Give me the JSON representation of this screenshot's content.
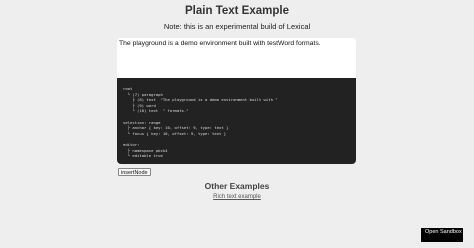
{
  "header": {
    "title": "Plain Text Example",
    "note": "Note: this is an experimental build of Lexical"
  },
  "editor": {
    "text": "The playground is a demo environment built with testWord formats."
  },
  "tree_view": {
    "lines": [
      "root",
      "  └ (7) paragraph",
      "    ├ (8) text  \"The playground is a demo environment built with \"",
      "    ├ (9) word",
      "    └ (10) text  \" formats.\"",
      "",
      "selection: range",
      "  ├ anchor { key: 10, offset: 9, type: text }",
      "  └ focus { key: 10, offset: 9, type: text }",
      "",
      "editor:",
      "  ├ namespace pbck4",
      "  └ editable true"
    ]
  },
  "toolbar": {
    "insert_node_label": "insertNode"
  },
  "other_examples": {
    "title": "Other Examples",
    "link_label": "Rich text example"
  },
  "sandbox": {
    "label": "Open Sandbox"
  }
}
